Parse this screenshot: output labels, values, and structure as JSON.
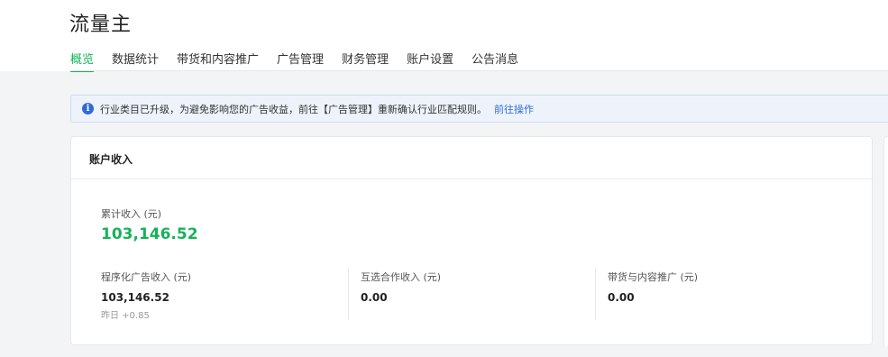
{
  "app": {
    "title": "流量主"
  },
  "tabs": [
    {
      "label": "概览",
      "active": true
    },
    {
      "label": "数据统计",
      "active": false
    },
    {
      "label": "带货和内容推广",
      "active": false
    },
    {
      "label": "广告管理",
      "active": false
    },
    {
      "label": "财务管理",
      "active": false
    },
    {
      "label": "账户设置",
      "active": false
    },
    {
      "label": "公告消息",
      "active": false
    }
  ],
  "notice": {
    "icon": "info-icon",
    "text": "行业类目已升级，为避免影响您的广告收益，前往【广告管理】重新确认行业匹配规则。",
    "link": "前往操作"
  },
  "account_income": {
    "title": "账户收入",
    "total_label": "累计收入 (元)",
    "total_value": "103,146.52",
    "metrics": [
      {
        "label": "程序化广告收入 (元)",
        "value": "103,146.52",
        "sub": "昨日 +0.85"
      },
      {
        "label": "互选合作收入 (元)",
        "value": "0.00",
        "sub": ""
      },
      {
        "label": "带货与内容推广 (元)",
        "value": "0.00",
        "sub": ""
      }
    ]
  },
  "colors": {
    "accent": "#15b35a",
    "link": "#2f6bd6",
    "notice_bg": "#eef3fb"
  }
}
